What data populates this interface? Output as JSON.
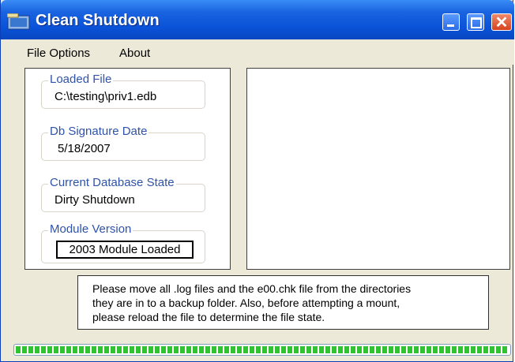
{
  "window": {
    "title": "Clean Shutdown",
    "close_glyph": "✕",
    "icon": "app-icon"
  },
  "menu": {
    "items": [
      "File Options",
      "About"
    ]
  },
  "fields": {
    "loaded_file": {
      "label": "Loaded File",
      "value": "C:\\testing\\priv1.edb"
    },
    "db_signature_date": {
      "label": "Db Signature Date",
      "value": "5/18/2007"
    },
    "current_database_state": {
      "label": "Current Database State",
      "value": "Dirty Shutdown"
    },
    "module_version": {
      "label": "Module Version",
      "value": "2003 Module Loaded"
    }
  },
  "message": {
    "lines": [
      "Please move all .log files and the e00.chk file from the  directories",
      "they are in to a backup folder. Also, before attempting a mount,",
      "please reload the file to determine  the file state."
    ]
  },
  "progress": {
    "fraction": 1.0
  },
  "colors": {
    "title_bar": "#0a52d8",
    "group_label": "#2f53a8",
    "progress": "#2fc42f"
  }
}
